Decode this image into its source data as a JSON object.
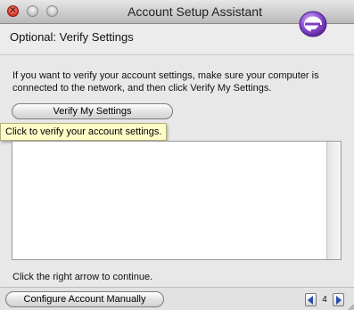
{
  "window": {
    "title": "Account Setup Assistant"
  },
  "header": {
    "title": "Optional: Verify Settings",
    "logo_icon": "entourage-e-icon",
    "logo_color": "#7b3fbf"
  },
  "body": {
    "instruction": "If you want to verify your account settings, make sure your computer is connected to the network, and then click Verify My Settings.",
    "verify_button_label": "Verify My Settings",
    "tooltip": "Click to verify your account settings.",
    "continue_hint": "Click the right arrow to continue."
  },
  "footer": {
    "configure_button_label": "Configure Account Manually",
    "page_number": "4",
    "prev_icon": "arrow-left-icon",
    "next_icon": "arrow-right-icon"
  },
  "colors": {
    "tooltip_bg": "#fefdc8",
    "close_button": "#e0443a",
    "arrow_color": "#2b4fa8"
  }
}
